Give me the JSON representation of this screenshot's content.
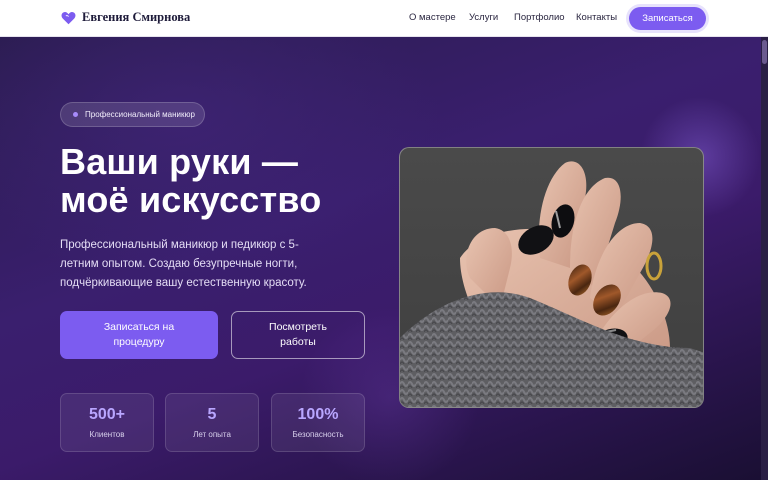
{
  "header": {
    "brand": "Евгения Смирнова",
    "nav": [
      "О мастере",
      "Услуги",
      "Портфолио",
      "Контакты"
    ],
    "cta": "Записаться"
  },
  "hero": {
    "badge": "Профессиональный маникюр",
    "title_line1": "Ваши руки —",
    "title_line2": "моё искусство",
    "description": "Профессиональный маникюр и педикюр с 5-летним опытом. Создаю безупречные ногти, подчёркивающие вашу естественную красоту.",
    "primary_button": "Записаться на процедуру",
    "secondary_button": "Посмотреть работы",
    "stats": [
      {
        "value": "500+",
        "label": "Клиентов"
      },
      {
        "value": "5",
        "label": "Лет опыта"
      },
      {
        "value": "100%",
        "label": "Безопасность"
      }
    ]
  },
  "colors": {
    "accent": "#7c5cf0",
    "accent_light": "#b9a6ff",
    "hero_dark": "#1a0f33",
    "hero_mid": "#3a1f6e"
  },
  "icons": {
    "logo": "heart-icon",
    "badge": "dot-icon"
  }
}
